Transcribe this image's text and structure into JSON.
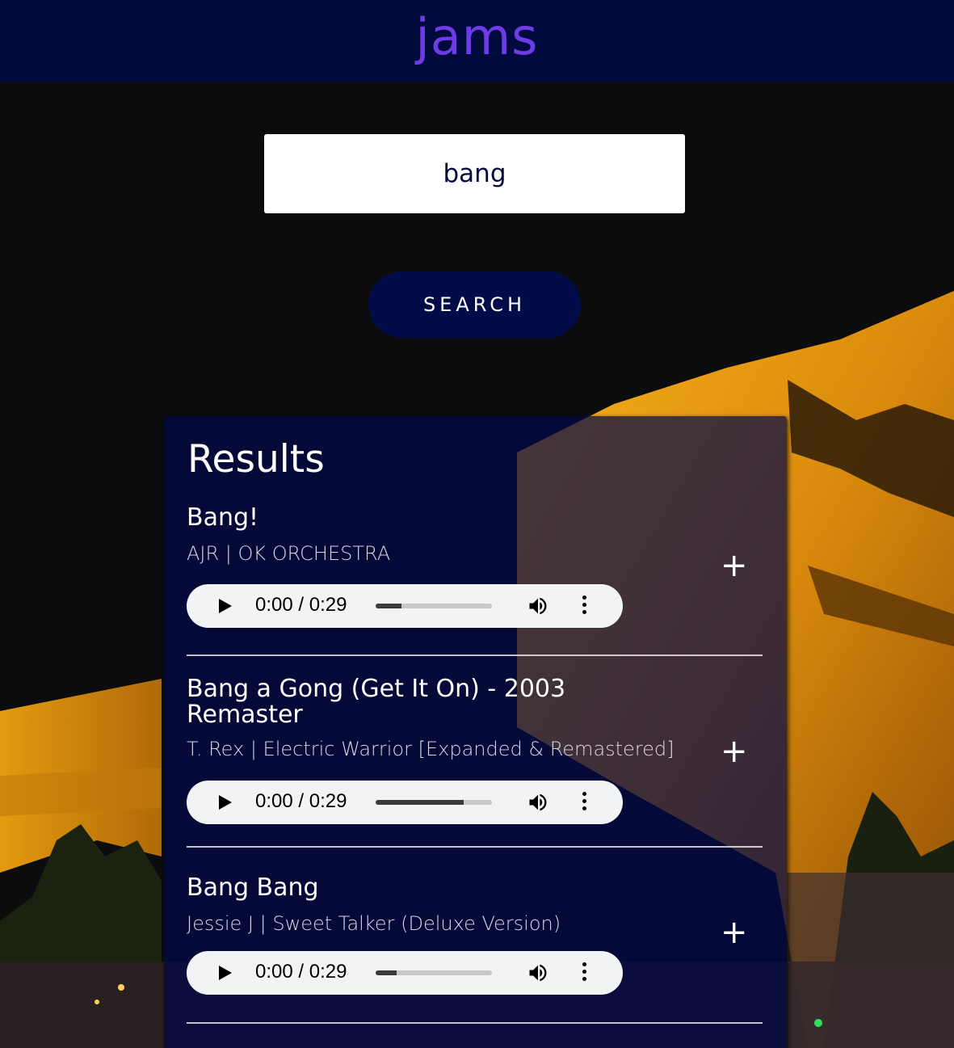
{
  "header": {
    "brand": "jams"
  },
  "search": {
    "value": "bang",
    "button_label": "SEARCH"
  },
  "results": {
    "title": "Results",
    "tracks": [
      {
        "name": "Bang!",
        "meta": "AJR | OK ORCHESTRA",
        "add_label": "+",
        "player": {
          "time": "0:00 / 0:29",
          "progress": 0.22
        }
      },
      {
        "name": "Bang a Gong (Get It On) - 2003 Remaster",
        "meta": "T. Rex | Electric Warrior [Expanded & Remastered]",
        "add_label": "+",
        "player": {
          "time": "0:00 / 0:29",
          "progress": 0.76
        }
      },
      {
        "name": "Bang Bang",
        "meta": "Jessie J | Sweet Talker (Deluxe Version)",
        "add_label": "+",
        "player": {
          "time": "0:00 / 0:29",
          "progress": 0.18
        }
      }
    ]
  },
  "icons": {
    "play": "play-icon",
    "volume": "volume-icon",
    "menu": "more-vertical-icon",
    "add": "plus-icon"
  },
  "colors": {
    "header_bg": "#010a3d",
    "brand": "#6e3ce6",
    "button_bg": "#010c48",
    "panel_bg": "#020848",
    "player_bg": "#f1f3f4"
  }
}
